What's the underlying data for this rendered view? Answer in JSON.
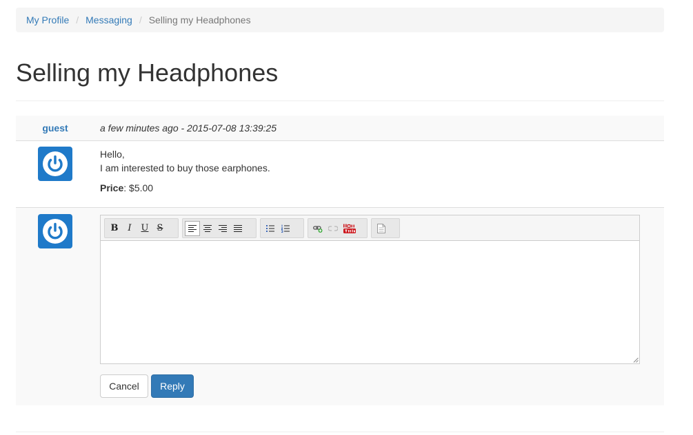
{
  "breadcrumb": {
    "items": [
      {
        "label": "My Profile"
      },
      {
        "label": "Messaging"
      }
    ],
    "separator": "/",
    "current": "Selling my Headphones"
  },
  "page_title": "Selling my Headphones",
  "message": {
    "author": "guest",
    "timestamp": "a few minutes ago - 2015-07-08 13:39:25",
    "lines": [
      "Hello,",
      "I am interested to buy those earphones."
    ],
    "price_label": "Price",
    "price_value": ": $5.00",
    "avatar_icon": "power-icon"
  },
  "reply": {
    "avatar_icon": "power-icon",
    "editor_value": "",
    "toolbar": {
      "bold_glyph": "B",
      "italic_glyph": "I",
      "underline_glyph": "U",
      "strike_glyph": "S"
    },
    "cancel_label": "Cancel",
    "reply_label": "Reply"
  },
  "colors": {
    "link": "#337ab7",
    "primary": "#337ab7",
    "avatar": "#1f7ac9"
  }
}
